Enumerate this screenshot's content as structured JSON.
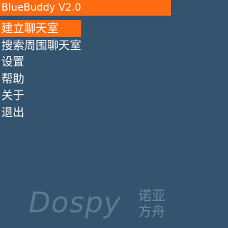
{
  "app": {
    "title": "BlueBuddy V2.0"
  },
  "menu": {
    "items": [
      {
        "label": "建立聊天室",
        "selected": true
      },
      {
        "label": "搜索周围聊天室",
        "selected": false
      },
      {
        "label": "设置",
        "selected": false
      },
      {
        "label": "帮助",
        "selected": false
      },
      {
        "label": "关于",
        "selected": false
      },
      {
        "label": "退出",
        "selected": false
      }
    ]
  },
  "watermark": {
    "brand": "Dospy",
    "cn_line1": "诺亚",
    "cn_line2": "方舟"
  },
  "colors": {
    "background": "#33536f",
    "accent": "#ff6b10",
    "text": "#ffffff"
  }
}
